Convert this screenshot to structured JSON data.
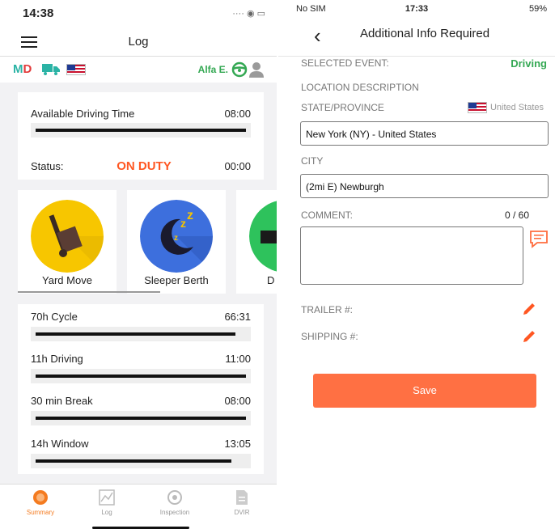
{
  "left": {
    "status_time": "14:38",
    "nav_title": "Log",
    "info": {
      "md_m": "M",
      "md_d": "D",
      "driver_name": "Alfa E."
    },
    "available": {
      "label": "Available Driving Time",
      "value": "08:00",
      "progress": 1.0
    },
    "status": {
      "label": "Status:",
      "value": "ON DUTY",
      "time": "00:00"
    },
    "modes": [
      {
        "label": "Yard Move",
        "color": "#f7c600"
      },
      {
        "label": "Sleeper Berth",
        "color": "#3d6fdd"
      },
      {
        "label": "D",
        "color": "#2ec25c"
      }
    ],
    "timers": [
      {
        "label": "70h Cycle",
        "value": "66:31",
        "progress": 0.95
      },
      {
        "label": "11h Driving",
        "value": "11:00",
        "progress": 1.0
      },
      {
        "label": "30 min Break",
        "value": "08:00",
        "progress": 1.0
      },
      {
        "label": "14h Window",
        "value": "13:05",
        "progress": 0.93
      }
    ],
    "tabs": [
      {
        "label": "Summary",
        "icon": "clock-icon",
        "active": true
      },
      {
        "label": "Log",
        "icon": "chart-icon",
        "active": false
      },
      {
        "label": "Inspection",
        "icon": "inspection-icon",
        "active": false
      },
      {
        "label": "DVIR",
        "icon": "document-icon",
        "active": false
      }
    ],
    "accent_color": "#ff5722"
  },
  "right": {
    "status": {
      "carrier": "No SIM",
      "time": "17:33",
      "battery": "59%"
    },
    "nav_title": "Additional Info Required",
    "selected_event_label": "SELECTED EVENT:",
    "selected_event_value": "Driving",
    "location_description_label": "LOCATION DESCRIPTION",
    "state_label": "STATE/PROVINCE",
    "country": "United States",
    "state_value": "New York (NY) - United States",
    "city_label": "CITY",
    "city_value": "(2mi E) Newburgh",
    "comment_label": "COMMENT:",
    "comment_counter": "0 / 60",
    "comment_value": "",
    "trailer_label": "TRAILER #:",
    "shipping_label": "SHIPPING #:",
    "save_label": "Save",
    "save_color": "#ff7043",
    "driving_color": "#34a853"
  }
}
